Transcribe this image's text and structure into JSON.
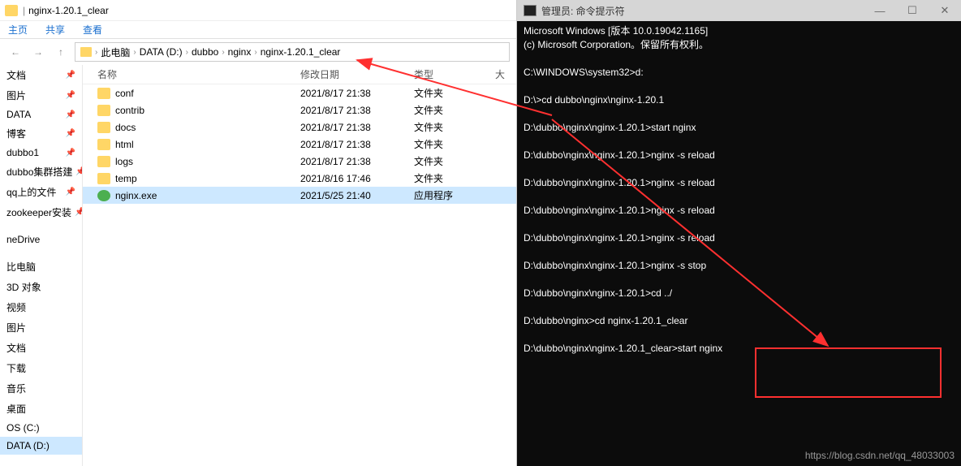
{
  "explorer": {
    "title": "nginx-1.20.1_clear",
    "ribbon": [
      "主页",
      "共享",
      "查看"
    ],
    "breadcrumb": [
      "此电脑",
      "DATA (D:)",
      "dubbo",
      "nginx",
      "nginx-1.20.1_clear"
    ],
    "columns": {
      "name": "名称",
      "date": "修改日期",
      "type": "类型",
      "size": "大"
    },
    "nav": [
      {
        "label": "文档",
        "pin": true
      },
      {
        "label": "图片",
        "pin": true
      },
      {
        "label": "DATA",
        "pin": true
      },
      {
        "label": "博客",
        "pin": true
      },
      {
        "label": "dubbo1",
        "pin": true
      },
      {
        "label": "dubbo集群搭建",
        "pin": true
      },
      {
        "label": "qq上的文件",
        "pin": true
      },
      {
        "label": "zookeeper安装",
        "pin": true
      },
      {
        "label": "",
        "spacer": true
      },
      {
        "label": "neDrive"
      },
      {
        "label": "",
        "spacer": true
      },
      {
        "label": "比电脑"
      },
      {
        "label": "3D 对象"
      },
      {
        "label": "视频"
      },
      {
        "label": "图片"
      },
      {
        "label": "文档"
      },
      {
        "label": "下载"
      },
      {
        "label": "音乐"
      },
      {
        "label": "桌面"
      },
      {
        "label": "OS (C:)"
      },
      {
        "label": "DATA (D:)",
        "sel": true
      }
    ],
    "files": [
      {
        "name": "conf",
        "date": "2021/8/17 21:38",
        "type": "文件夹",
        "icon": "folder"
      },
      {
        "name": "contrib",
        "date": "2021/8/17 21:38",
        "type": "文件夹",
        "icon": "folder"
      },
      {
        "name": "docs",
        "date": "2021/8/17 21:38",
        "type": "文件夹",
        "icon": "folder"
      },
      {
        "name": "html",
        "date": "2021/8/17 21:38",
        "type": "文件夹",
        "icon": "folder"
      },
      {
        "name": "logs",
        "date": "2021/8/17 21:38",
        "type": "文件夹",
        "icon": "folder"
      },
      {
        "name": "temp",
        "date": "2021/8/16 17:46",
        "type": "文件夹",
        "icon": "folder"
      },
      {
        "name": "nginx.exe",
        "date": "2021/5/25 21:40",
        "type": "应用程序",
        "icon": "exe",
        "sel": true
      }
    ]
  },
  "terminal": {
    "title": "管理员: 命令提示符",
    "lines": [
      "Microsoft Windows [版本 10.0.19042.1165]",
      "(c) Microsoft Corporation。保留所有权利。",
      "",
      "C:\\WINDOWS\\system32>d:",
      "",
      "D:\\>cd dubbo\\nginx\\nginx-1.20.1",
      "",
      "D:\\dubbo\\nginx\\nginx-1.20.1>start nginx",
      "",
      "D:\\dubbo\\nginx\\nginx-1.20.1>nginx -s reload",
      "",
      "D:\\dubbo\\nginx\\nginx-1.20.1>nginx -s reload",
      "",
      "D:\\dubbo\\nginx\\nginx-1.20.1>nginx -s reload",
      "",
      "D:\\dubbo\\nginx\\nginx-1.20.1>nginx -s reload",
      "",
      "D:\\dubbo\\nginx\\nginx-1.20.1>nginx -s stop",
      "",
      "D:\\dubbo\\nginx\\nginx-1.20.1>cd ../",
      "",
      "D:\\dubbo\\nginx>cd nginx-1.20.1_clear",
      "",
      "D:\\dubbo\\nginx\\nginx-1.20.1_clear>start nginx",
      ""
    ]
  },
  "win_controls": {
    "min": "—",
    "max": "☐",
    "close": "✕"
  },
  "watermark": "https://blog.csdn.net/qq_48033003"
}
